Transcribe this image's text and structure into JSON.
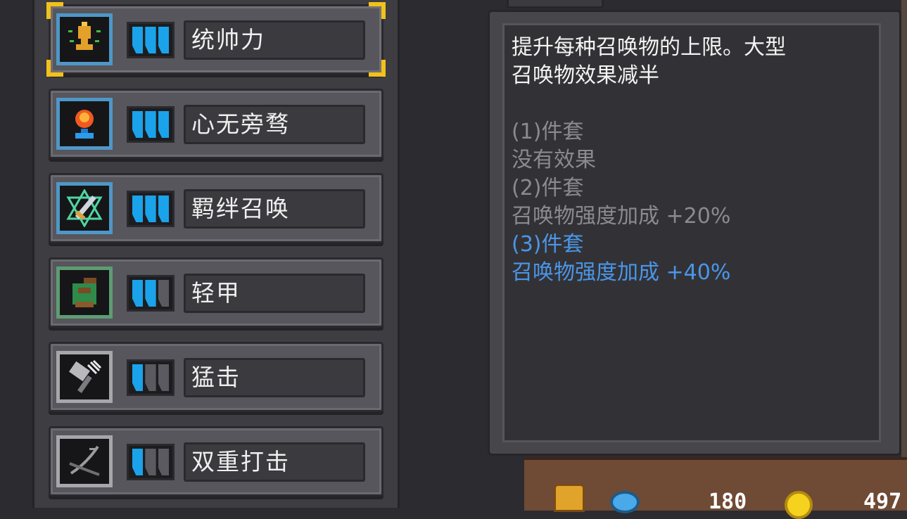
{
  "traits": [
    {
      "name": "统帅力",
      "icon": "trophy-icon",
      "frame": "blue",
      "level": 3,
      "max": 3,
      "selected": true
    },
    {
      "name": "心无旁骛",
      "icon": "flame-orb-icon",
      "frame": "blue",
      "level": 3,
      "max": 3,
      "selected": false
    },
    {
      "name": "羁绊召唤",
      "icon": "summon-sword-icon",
      "frame": "blue",
      "level": 3,
      "max": 3,
      "selected": false
    },
    {
      "name": "轻甲",
      "icon": "light-armor-icon",
      "frame": "green",
      "level": 2,
      "max": 3,
      "selected": false
    },
    {
      "name": "猛击",
      "icon": "hammer-icon",
      "frame": "gray",
      "level": 1,
      "max": 3,
      "selected": false
    },
    {
      "name": "双重打击",
      "icon": "double-strike-icon",
      "frame": "gray",
      "level": 1,
      "max": 3,
      "selected": false
    }
  ],
  "tooltip": {
    "description": [
      "提升每种召唤物的上限。大型",
      "召唤物效果减半"
    ],
    "set1_title": "(1)件套",
    "set1_effect": "没有效果",
    "set2_title": "(2)件套",
    "set2_effect": "召唤物强度加成 +20%",
    "set3_title": "(3)件套",
    "set3_effect": "召唤物强度加成 +40%"
  },
  "hud": {
    "gem_count": "180",
    "coin_count": "497"
  },
  "colors": {
    "active_bar": "#1aa3ea",
    "inactive_bar": "#5a5a60",
    "highlight_text": "#4b96e8",
    "selection_corner": "#f2c21a"
  }
}
